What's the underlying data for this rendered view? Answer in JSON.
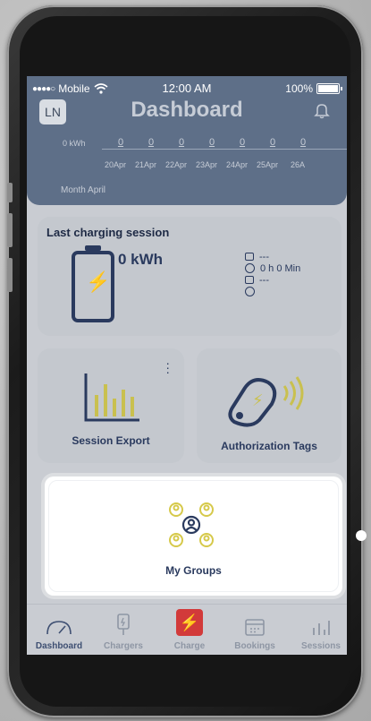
{
  "status_bar": {
    "carrier": "Mobile",
    "time": "12:00 AM",
    "battery": "100%"
  },
  "header": {
    "avatar": "LN",
    "title": "Dashboard",
    "chart": {
      "unit": "0 kWh",
      "values": [
        "0",
        "0",
        "0",
        "0",
        "0",
        "0",
        "0"
      ],
      "dates": [
        "20Apr",
        "21Apr",
        "22Apr",
        "23Apr",
        "24Apr",
        "25Apr",
        "26A"
      ],
      "month_label": "Month April"
    }
  },
  "last_session": {
    "title": "Last charging session",
    "energy": "0 kWh",
    "date": "---",
    "duration": "0 h 0 Min",
    "end": "---"
  },
  "tiles": {
    "export": "Session Export",
    "tags": "Authorization Tags",
    "groups": "My Groups"
  },
  "nav": {
    "dashboard": "Dashboard",
    "chargers": "Chargers",
    "charge": "Charge",
    "bookings": "Bookings",
    "sessions": "Sessions"
  },
  "colors": {
    "header": "#5e6f88",
    "accent_yellow": "#c9c04f",
    "navy": "#2a3a5e",
    "charge_red": "#d23a3a"
  }
}
